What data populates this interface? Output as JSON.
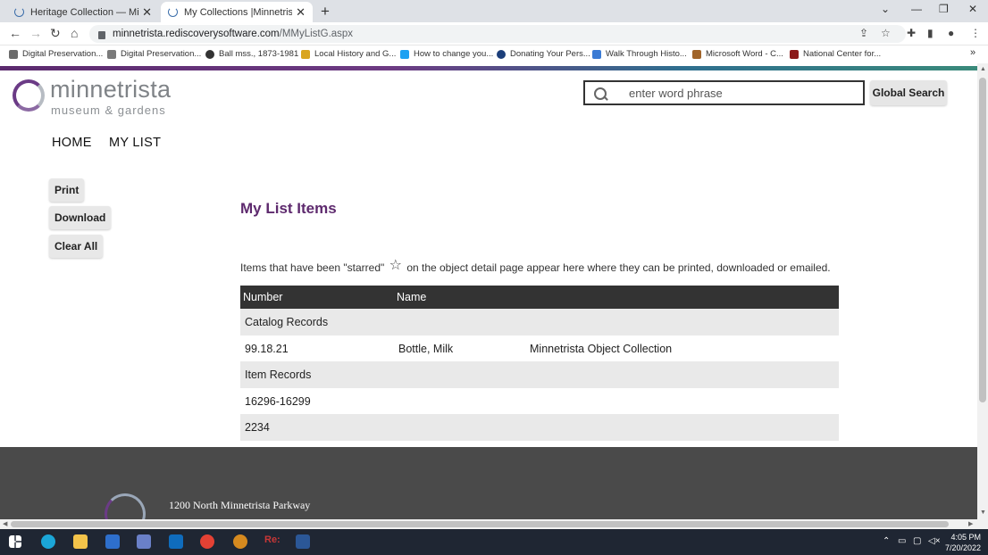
{
  "browser": {
    "tabs": [
      {
        "title": "Heritage Collection — Minnetrist",
        "active": false
      },
      {
        "title": "My Collections |Minnetrista",
        "active": true
      }
    ],
    "new_tab": "+",
    "url_domain": "minnetrista.rediscoverysoftware.com",
    "url_path": "/MMyListG.aspx",
    "bookmarks": [
      "Digital Preservation...",
      "Digital Preservation...",
      "Ball mss., 1873-1981",
      "Local History and G...",
      "How to change you...",
      "Donating Your Pers...",
      "Walk Through Histo...",
      "Microsoft Word - C...",
      "National Center for..."
    ],
    "bookmarks_more": "»"
  },
  "site": {
    "logo_name": "minnetrista",
    "logo_sub": "museum & gardens",
    "search_placeholder": "enter word phrase",
    "search_button": "Global Search",
    "menu": {
      "home": "HOME",
      "my_list": "MY LIST"
    },
    "side_buttons": {
      "print": "Print",
      "download": "Download",
      "clear_all": "Clear All"
    }
  },
  "main": {
    "title": "My List Items",
    "intro_before": "Items that have been \"starred\"",
    "intro_after": "on the object detail page appear here where they can be printed, downloaded or emailed.",
    "star_icon": "☆",
    "table": {
      "headers": {
        "number": "Number",
        "name": "Name"
      },
      "rows": [
        {
          "number": "Catalog Records",
          "name": "",
          "collection": "",
          "shade": true
        },
        {
          "number": "99.18.21",
          "name": "Bottle, Milk",
          "collection": "Minnetrista Object Collection",
          "shade": false
        },
        {
          "number": "Item Records",
          "name": "",
          "collection": "",
          "shade": true
        },
        {
          "number": "16296-16299",
          "name": "",
          "collection": "",
          "shade": false
        },
        {
          "number": "2234",
          "name": "",
          "collection": "",
          "shade": true
        }
      ]
    }
  },
  "footer": {
    "address": "1200 North Minnetrista Parkway"
  },
  "taskbar": {
    "time": "4:05 PM",
    "date": "7/20/2022"
  }
}
